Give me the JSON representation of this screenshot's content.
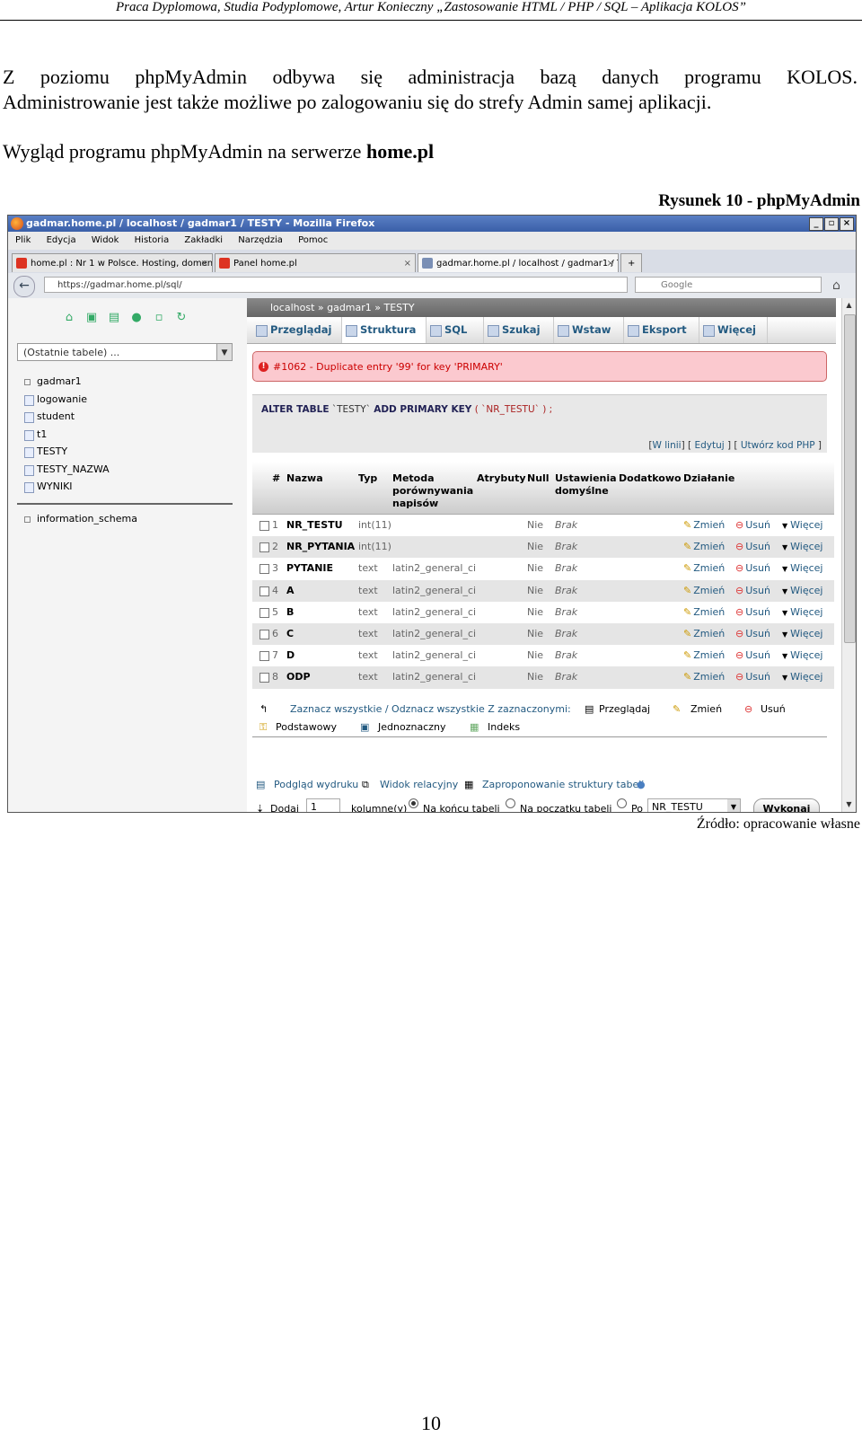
{
  "doc": {
    "header": "Praca Dyplomowa, Studia Podyplomowe, Artur Konieczny „Zastosowanie HTML / PHP / SQL – Aplikacja KOLOS”",
    "para1_line1": "Z poziomu phpMyAdmin odbywa się administracja bazą danych programu KOLOS.",
    "para1_line2": "Administrowanie jest także możliwe po zalogowaniu się do strefy Admin samej aplikacji.",
    "para2_text": "Wygląd programu phpMyAdmin na serwerze ",
    "para2_bold": "home.pl",
    "figure_caption": "Rysunek 10 - phpMyAdmin",
    "source": "Źródło: opracowanie własne",
    "page_number": "10"
  },
  "browser": {
    "window_title": "gadmar.home.pl / localhost / gadmar1 / TESTY - Mozilla Firefox",
    "win_buttons": [
      "_",
      "▫",
      "×"
    ],
    "menu": [
      "Plik",
      "Edycja",
      "Widok",
      "Historia",
      "Zakładki",
      "Narzędzia",
      "Pomoc"
    ],
    "tabs": [
      {
        "label": "home.pl : Nr 1 w Polsce. Hosting, domen...",
        "close": "×"
      },
      {
        "label": "Panel home.pl",
        "close": "×"
      },
      {
        "label": "gadmar.home.pl / localhost / gadmar1 / T...",
        "close": "×"
      }
    ],
    "new_tab": "+",
    "url": "https://gadmar.home.pl/sql/",
    "search_placeholder": "Google",
    "back_icon": "←",
    "home_icon": "⌂"
  },
  "pma_left": {
    "recent_tables": "(Ostatnie tabele) ...",
    "recent_arrow": "▼",
    "tree": {
      "db1": "gadmar1",
      "tables": [
        "logowanie",
        "student",
        "t1",
        "TESTY",
        "TESTY_NAZWA",
        "WYNIKI"
      ],
      "db2": "information_schema"
    }
  },
  "pma_right": {
    "breadcrumb": "localhost » gadmar1 » TESTY",
    "tabs": [
      "Przeglądaj",
      "Struktura",
      "SQL",
      "Szukaj",
      "Wstaw",
      "Eksport",
      "Więcej"
    ],
    "error": "#1062 - Duplicate entry '99' for key 'PRIMARY'",
    "sql_kw": "ALTER TABLE",
    "sql_tbl": " `TESTY` ",
    "sql_kw2": "ADD PRIMARY KEY",
    "sql_rest": " ( `NR_TESTU` ) ;",
    "link_inline": "W linii",
    "link_edit": "Edytuj",
    "link_php": "Utwórz kod PHP",
    "columns": {
      "hash": "#",
      "name": "Nazwa",
      "type": "Typ",
      "collation": "Metoda porównywania napisów",
      "attributes": "Atrybuty",
      "null": "Null",
      "default": "Ustawienia domyślne",
      "extra": "Dodatkowo",
      "action": "Działanie"
    },
    "rows": [
      {
        "n": "1",
        "name": "NR_TESTU",
        "type": "int(11)",
        "coll": "",
        "null": "Nie",
        "def": "Brak"
      },
      {
        "n": "2",
        "name": "NR_PYTANIA",
        "type": "int(11)",
        "coll": "",
        "null": "Nie",
        "def": "Brak"
      },
      {
        "n": "3",
        "name": "PYTANIE",
        "type": "text",
        "coll": "latin2_general_ci",
        "null": "Nie",
        "def": "Brak"
      },
      {
        "n": "4",
        "name": "A",
        "type": "text",
        "coll": "latin2_general_ci",
        "null": "Nie",
        "def": "Brak"
      },
      {
        "n": "5",
        "name": "B",
        "type": "text",
        "coll": "latin2_general_ci",
        "null": "Nie",
        "def": "Brak"
      },
      {
        "n": "6",
        "name": "C",
        "type": "text",
        "coll": "latin2_general_ci",
        "null": "Nie",
        "def": "Brak"
      },
      {
        "n": "7",
        "name": "D",
        "type": "text",
        "coll": "latin2_general_ci",
        "null": "Nie",
        "def": "Brak"
      },
      {
        "n": "8",
        "name": "ODP",
        "type": "text",
        "coll": "latin2_general_ci",
        "null": "Nie",
        "def": "Brak"
      }
    ],
    "act_edit": "Zmień",
    "act_delete": "Usuń",
    "act_more": "Więcej",
    "check_all": "Zaznacz wszystkie / Odznacz wszystkie Z zaznaczonymi:",
    "bulk_browse": "Przeglądaj",
    "bulk_edit": "Zmień",
    "bulk_delete": "Usuń",
    "bulk_primary": "Podstawowy",
    "bulk_unique": "Jednoznaczny",
    "bulk_index": "Indeks",
    "print_view": "Podgląd wydruku",
    "relation_view": "Widok relacyjny",
    "propose_structure": "Zaproponowanie struktury tabeli",
    "add_label": "Dodaj",
    "add_count": "1",
    "add_columns": "kolumnę(y)",
    "at_end": "Na końcu tabeli",
    "at_begin": "Na początku tabeli",
    "after": "Po",
    "after_column": "NR_TESTU",
    "go": "Wykonaj"
  }
}
